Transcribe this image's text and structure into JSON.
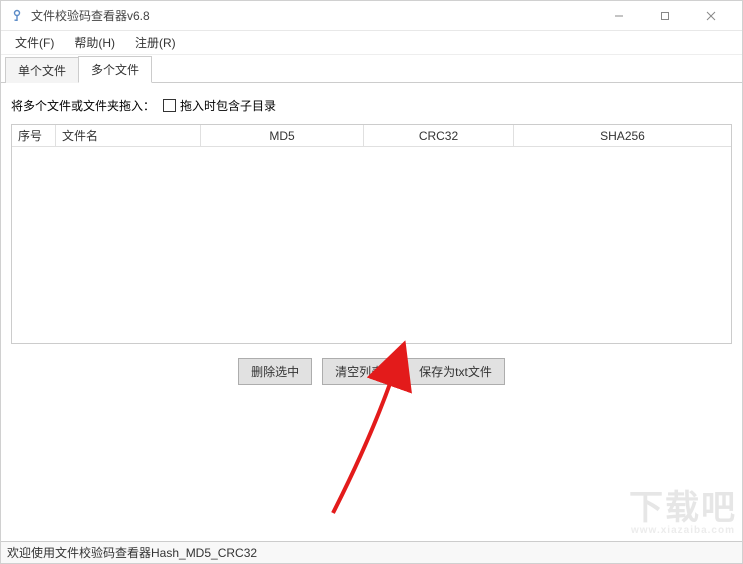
{
  "window": {
    "title": "文件校验码查看器v6.8"
  },
  "menubar": {
    "file": "文件(F)",
    "help": "帮助(H)",
    "register": "注册(R)"
  },
  "tabs": {
    "single": "单个文件",
    "multi": "多个文件"
  },
  "options": {
    "drag_hint": "将多个文件或文件夹拖入：",
    "include_subdir": "拖入时包含子目录"
  },
  "table": {
    "headers": {
      "index": "序号",
      "filename": "文件名",
      "md5": "MD5",
      "crc32": "CRC32",
      "sha256": "SHA256"
    }
  },
  "buttons": {
    "delete_selected": "删除选中",
    "clear_list": "清空列表",
    "save_txt": "保存为txt文件"
  },
  "status": {
    "text": "欢迎使用文件校验码查看器Hash_MD5_CRC32"
  },
  "watermark": {
    "main": "下载吧",
    "sub": "www.xiazaiba.com"
  }
}
